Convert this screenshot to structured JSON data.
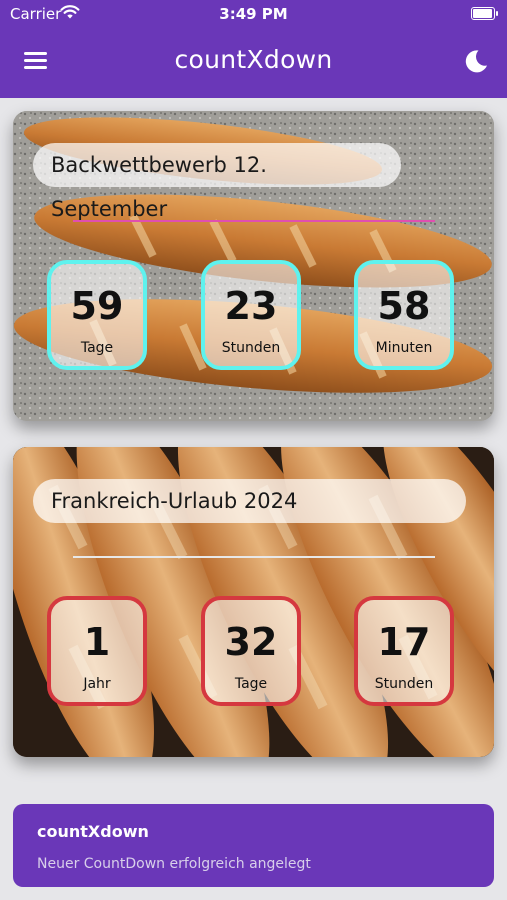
{
  "status_bar": {
    "carrier": "Carrier",
    "time": "3:49 PM",
    "wifi_icon": "wifi-icon",
    "battery_icon": "battery-icon"
  },
  "nav": {
    "title": "countXdown",
    "menu_icon": "hamburger-menu-icon",
    "theme_icon": "moon-icon"
  },
  "countdowns": [
    {
      "title": "Backwettbewerb 12. September",
      "accent": "#5ff2ee",
      "divider": "#e04fb0",
      "image": "bread-rolls-photo",
      "units": [
        {
          "value": "59",
          "label": "Tage"
        },
        {
          "value": "23",
          "label": "Stunden"
        },
        {
          "value": "58",
          "label": "Minuten"
        }
      ]
    },
    {
      "title": "Frankreich-Urlaub 2024",
      "accent": "#d5383f",
      "divider": "#e8e8e8",
      "image": "baguettes-photo",
      "units": [
        {
          "value": "1",
          "label": "Jahr"
        },
        {
          "value": "32",
          "label": "Tage"
        },
        {
          "value": "17",
          "label": "Stunden"
        }
      ]
    }
  ],
  "toast": {
    "title": "countXdown",
    "message": "Neuer CountDown erfolgreich angelegt"
  },
  "colors": {
    "primary": "#6a37b8",
    "background": "#e6e6e9"
  }
}
